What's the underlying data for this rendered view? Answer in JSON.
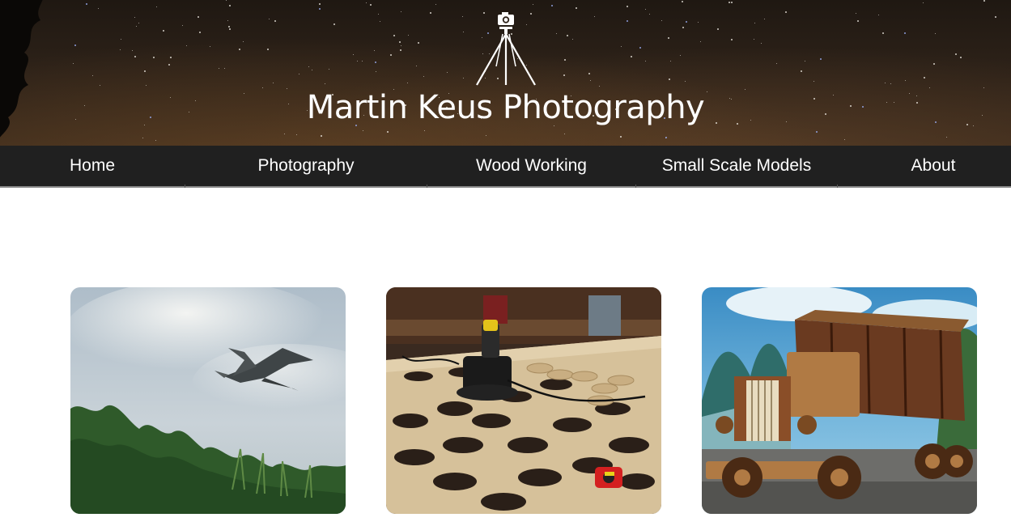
{
  "header": {
    "title": "Martin Keus Photography",
    "logo_icon": "camera-tripod-icon"
  },
  "nav": {
    "items": [
      {
        "label": "Home"
      },
      {
        "label": "Photography"
      },
      {
        "label": "Wood Working"
      },
      {
        "label": "Small Scale Models"
      },
      {
        "label": "About"
      }
    ]
  },
  "cards": [
    {
      "image": "heron-in-flight-photo"
    },
    {
      "image": "plywood-router-workbench-photo"
    },
    {
      "image": "wooden-truck-model-photo"
    }
  ],
  "colors": {
    "navbar_bg": "#202020",
    "header_sky": "#2c2118",
    "text": "#ffffff"
  }
}
